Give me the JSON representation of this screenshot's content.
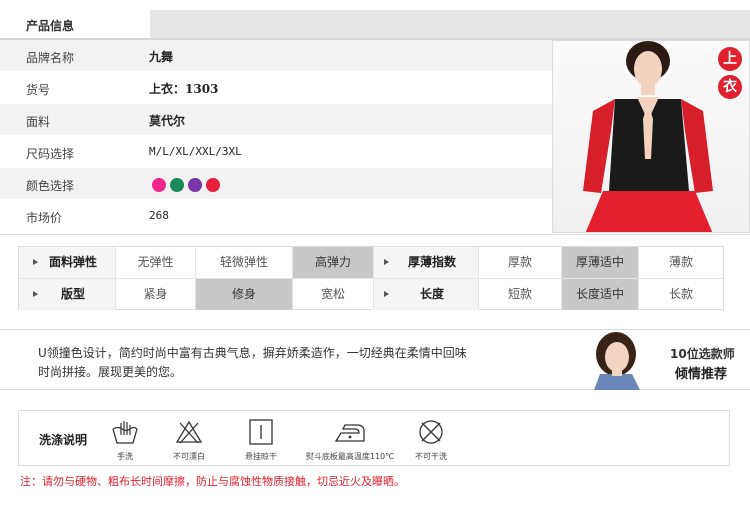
{
  "header": {
    "title": "产品信息"
  },
  "info": {
    "brand": {
      "key": "品牌名称",
      "value": "九舞"
    },
    "sku": {
      "key": "货号",
      "value": "上衣：1303"
    },
    "fabric": {
      "key": "面料",
      "value": "莫代尔"
    },
    "size": {
      "key": "尺码选择",
      "value": "M/L/XL/XXL/3XL"
    },
    "color": {
      "key": "颜色选择",
      "swatches": [
        "#f0288c",
        "#1a8a5a",
        "#7a35a8",
        "#e8203a"
      ]
    },
    "price": {
      "key": "市场价",
      "value": "268"
    }
  },
  "photo": {
    "badge1": "上",
    "badge2": "衣"
  },
  "attributes": {
    "elasticity_label": "面料弹性",
    "elasticity_opts": [
      "无弹性",
      "轻微弹性",
      "高弹力"
    ],
    "elasticity_selected": "高弹力",
    "thickness_label": "厚薄指数",
    "thickness_opts": [
      "厚款",
      "厚薄适中",
      "薄款"
    ],
    "thickness_selected": "厚薄适中",
    "fit_label": "版型",
    "fit_opts": [
      "紧身",
      "修身",
      "宽松"
    ],
    "fit_selected": "修身",
    "length_label": "长度",
    "length_opts": [
      "短款",
      "长度适中",
      "长款"
    ],
    "length_selected": "长度适中"
  },
  "designer": {
    "line1": "U领撞色设计，简约时尚中富有古典气息，摒弃娇柔造作，一切经典在柔情中回味",
    "line2": "时尚拼接。展现更美的您。",
    "title1": "10位选款师",
    "title2": "倾情推荐"
  },
  "wash": {
    "label": "洗涤说明",
    "items": [
      "手洗",
      "不可漂白",
      "悬挂晾干",
      "熨斗底板最高温度110℃",
      "不可干洗"
    ]
  },
  "note": "注：请勿与硬物、粗布长时间摩擦，防止与腐蚀性物质接触，切忌近火及曝晒。"
}
